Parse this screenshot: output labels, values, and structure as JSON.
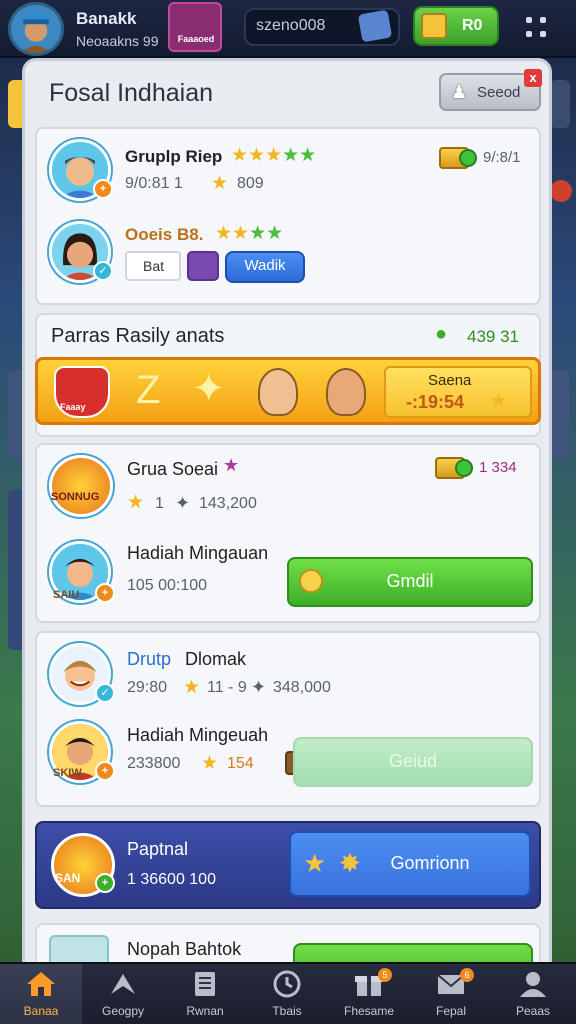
{
  "top_bar": {
    "player_name": "Banakk",
    "player_sub": "Neoaakns 99",
    "badge_label": "Faaaoed",
    "currency_value": "szeno008",
    "green_button_label": "R0"
  },
  "panel": {
    "title": "Fosal Indhaian",
    "search_button_label": "Seeod",
    "close_label": "x"
  },
  "top_card": {
    "row1": {
      "name": "Gruplp Riep",
      "score": "9/0:81 1",
      "stars_value": "809",
      "right_value": "9/:8/1"
    },
    "row2": {
      "name": "Ooeis B8.",
      "chip_label": "Bat",
      "button_label": "Wadik"
    }
  },
  "ranking": {
    "title": "Parras Rasily anats",
    "value": "439 31",
    "gold_badge_label": "Faaay",
    "gold_box_title": "Saena",
    "gold_box_value": "-:19:54"
  },
  "card_gruasoai": {
    "name": "Grua Soeai",
    "badge1_label": "SONNUG",
    "stars_text": "1",
    "score": "143,200",
    "right_value": "1 334",
    "row2_name": "Hadiah Mingauan",
    "row2_badge_label": "SAIU",
    "row2_value": "105 00:100",
    "button_label": "Gmdil"
  },
  "card_drutp": {
    "name_blue": "Drutp",
    "name_black": "Dlomak",
    "score_left": "29:80",
    "star_text": "11 - 9",
    "score": "348,000",
    "row2_name": "Hadiah Mingeuah",
    "row2_badge_label": "SKIW",
    "row2_value": "233800",
    "row2_star_value": "154",
    "button_label": "Geiud"
  },
  "purple_card": {
    "name": "Paptnal",
    "badge_label": "SAN",
    "value": "1 36600 100",
    "button_label": "Gomrionn"
  },
  "partial_card": {
    "name": "Nopah Bahtok"
  },
  "bottom_nav": [
    {
      "label": "Banaa",
      "icon": "home-icon",
      "active": true
    },
    {
      "label": "Geogpy",
      "icon": "wing-icon",
      "active": false
    },
    {
      "label": "Rwnan",
      "icon": "book-icon",
      "active": false
    },
    {
      "label": "Tbais",
      "icon": "clock-icon",
      "active": false
    },
    {
      "label": "Fhesame",
      "icon": "gift-icon",
      "active": false,
      "badge": "5"
    },
    {
      "label": "Fepal",
      "icon": "mail-icon",
      "active": false,
      "badge": "6"
    },
    {
      "label": "Peaas",
      "icon": "profile-icon",
      "active": false
    }
  ],
  "colors": {
    "accent_green": "#4fc22e",
    "accent_blue": "#2e6ad8",
    "accent_gold": "#f3a014",
    "active_nav": "#ffb546"
  }
}
